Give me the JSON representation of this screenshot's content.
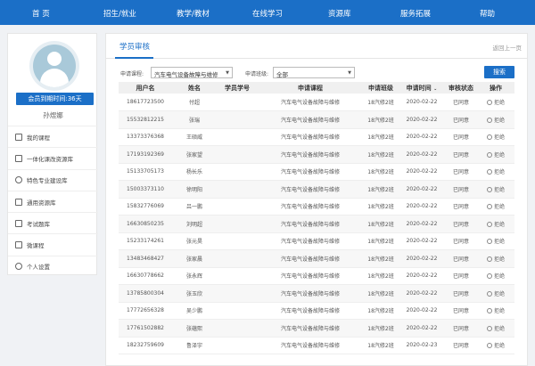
{
  "nav": {
    "items": [
      "首 页",
      "招生/就业",
      "教学/教材",
      "在线学习",
      "资源库",
      "服务拓展",
      "帮助"
    ]
  },
  "sidebar": {
    "member_button": "会员到期时间:36天",
    "username": "孙煜娜",
    "items": [
      {
        "label": "我的课程",
        "icon": "document-icon"
      },
      {
        "label": "一体化课改资源库",
        "icon": "book-icon"
      },
      {
        "label": "特色专业建设库",
        "icon": "target-icon"
      },
      {
        "label": "通用资源库",
        "icon": "grid-icon"
      },
      {
        "label": "考试题库",
        "icon": "file-icon"
      },
      {
        "label": "微课程",
        "icon": "video-icon"
      },
      {
        "label": "个人设置",
        "icon": "gear-icon"
      }
    ]
  },
  "main": {
    "tab_title": "学员审核",
    "back_link": "返回上一页",
    "filters": {
      "course_label": "申请课程:",
      "course_value": "汽车电气设备故障与维修",
      "class_label": "申请班级:",
      "class_value": "全部",
      "search_button": "搜索"
    },
    "table": {
      "headers": [
        "用户名",
        "姓名",
        "学员学号",
        "申请课程",
        "申请班级",
        "申请时间",
        "审核状态",
        "操作"
      ],
      "sort_icon": "chevron-down-icon",
      "rows": [
        [
          "18617723500",
          "付超",
          "",
          "汽车电气设备故障与维修",
          "18汽修2班",
          "2020-02-22",
          "已同意",
          "拒绝"
        ],
        [
          "15532812215",
          "张瑞",
          "",
          "汽车电气设备故障与维修",
          "18汽修2班",
          "2020-02-22",
          "已同意",
          "拒绝"
        ],
        [
          "13373376368",
          "王硕威",
          "",
          "汽车电气设备故障与维修",
          "18汽修2班",
          "2020-02-22",
          "已同意",
          "拒绝"
        ],
        [
          "17193192369",
          "张家望",
          "",
          "汽车电气设备故障与维修",
          "18汽修2班",
          "2020-02-22",
          "已同意",
          "拒绝"
        ],
        [
          "15133705173",
          "杨长乐",
          "",
          "汽车电气设备故障与维修",
          "18汽修2班",
          "2020-02-22",
          "已同意",
          "拒绝"
        ],
        [
          "15003373110",
          "徐明阳",
          "",
          "汽车电气设备故障与维修",
          "18汽修2班",
          "2020-02-22",
          "已同意",
          "拒绝"
        ],
        [
          "15832776069",
          "吕一鹏",
          "",
          "汽车电气设备故障与维修",
          "18汽修2班",
          "2020-02-22",
          "已同意",
          "拒绝"
        ],
        [
          "16630850235",
          "刘明超",
          "",
          "汽车电气设备故障与维修",
          "18汽修2班",
          "2020-02-22",
          "已同意",
          "拒绝"
        ],
        [
          "15233174261",
          "张元昊",
          "",
          "汽车电气设备故障与维修",
          "18汽修2班",
          "2020-02-22",
          "已同意",
          "拒绝"
        ],
        [
          "13483468427",
          "张家晨",
          "",
          "汽车电气设备故障与维修",
          "18汽修2班",
          "2020-02-22",
          "已同意",
          "拒绝"
        ],
        [
          "16630778662",
          "张永辉",
          "",
          "汽车电气设备故障与维修",
          "18汽修2班",
          "2020-02-22",
          "已同意",
          "拒绝"
        ],
        [
          "13785800304",
          "张玉欣",
          "",
          "汽车电气设备故障与维修",
          "18汽修2班",
          "2020-02-22",
          "已同意",
          "拒绝"
        ],
        [
          "17772656328",
          "吴少鹏",
          "",
          "汽车电气设备故障与维修",
          "18汽修2班",
          "2020-02-22",
          "已同意",
          "拒绝"
        ],
        [
          "17761502882",
          "张蕴熙",
          "",
          "汽车电气设备故障与维修",
          "18汽修2班",
          "2020-02-22",
          "已同意",
          "拒绝"
        ],
        [
          "18232759609",
          "鲁泽宇",
          "",
          "汽车电气设备故障与维修",
          "18汽修2班",
          "2020-02-23",
          "已同意",
          "拒绝"
        ]
      ]
    }
  },
  "colors": {
    "primary": "#1b6fc7",
    "background": "#f0f2f5"
  }
}
